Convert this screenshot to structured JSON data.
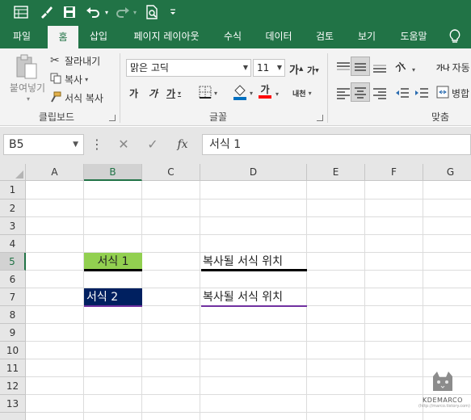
{
  "qat": {
    "icons": [
      "sheet-icon",
      "brush-icon",
      "save-icon",
      "undo-icon",
      "redo-icon",
      "print-preview-icon",
      "customize-icon"
    ]
  },
  "tabs": [
    {
      "label": "파일"
    },
    {
      "label": "홈",
      "active": true
    },
    {
      "label": "삽입"
    },
    {
      "label": "페이지 레이아웃"
    },
    {
      "label": "수식"
    },
    {
      "label": "데이터"
    },
    {
      "label": "검토"
    },
    {
      "label": "보기"
    },
    {
      "label": "도움말"
    }
  ],
  "ribbon": {
    "clipboard": {
      "paste_label": "붙여넣기",
      "cut_label": "잘라내기",
      "copy_label": "복사",
      "format_painter_label": "서식 복사",
      "group_label": "클립보드"
    },
    "font": {
      "font_name": "맑은 고딕",
      "font_size": "11",
      "grow_label": "가",
      "shrink_label": "가",
      "bold_label": "가",
      "italic_label": "가",
      "underline_label": "가",
      "phonetic_label": "내천",
      "font_color_label": "가",
      "group_label": "글꼴"
    },
    "alignment": {
      "orientation_label": "가",
      "wrap_label": "자동",
      "wrap_icon_label": "가나",
      "merge_label": "병합",
      "group_label": "맞춤"
    }
  },
  "formula_bar": {
    "name_box": "B5",
    "more_label": "⋮",
    "cancel_label": "✕",
    "enter_label": "✓",
    "fx_label": "fx",
    "formula": "서식 1"
  },
  "grid": {
    "columns": [
      "A",
      "B",
      "C",
      "D",
      "E",
      "F",
      "G"
    ],
    "rows": [
      "1",
      "2",
      "3",
      "4",
      "5",
      "6",
      "7",
      "8",
      "9",
      "10",
      "11",
      "12",
      "13"
    ],
    "cells": {
      "B5": "서식 1",
      "D5": "복사될 서식 위치",
      "B7": "서식 2",
      "D7": "복사될 서식 위치"
    },
    "colors": {
      "B5_fill": "#92d050",
      "B7_fill": "#002060",
      "B7_text": "#ffffff",
      "D7_border": "#7030a0"
    }
  },
  "watermark": {
    "title": "KDEMARCO",
    "subtitle": "(http://marco.tistory.com)"
  }
}
